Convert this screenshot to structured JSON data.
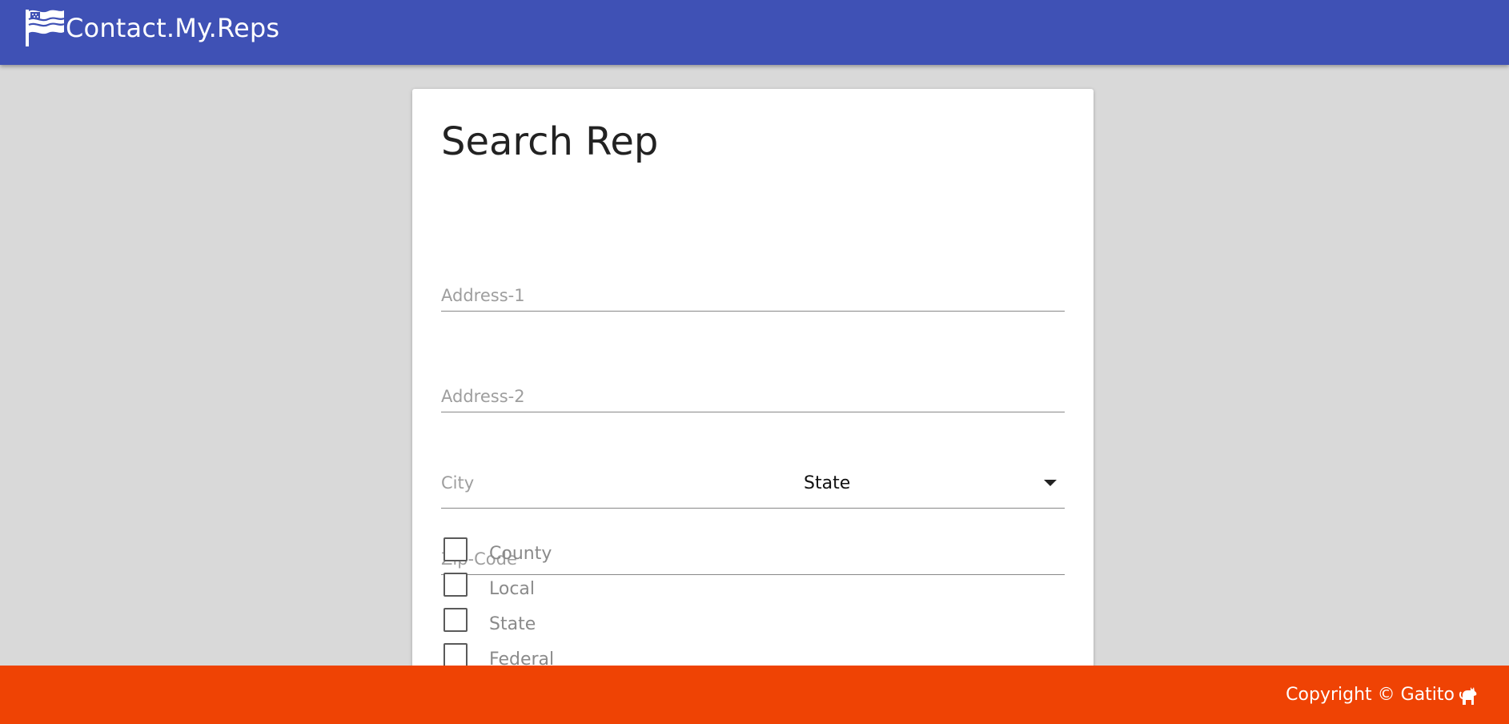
{
  "header": {
    "title": "Contact.My.Reps",
    "logo_icon": "flag-icon",
    "background": "#3f51b5"
  },
  "form": {
    "title": "Search Rep",
    "address1_placeholder": "Address-1",
    "address2_placeholder": "Address-2",
    "city_placeholder": "City",
    "state_selected": "State",
    "zip_placeholder": "Zip-Code",
    "levels": [
      {
        "label": "County",
        "checked": false
      },
      {
        "label": "Local",
        "checked": false
      },
      {
        "label": "State",
        "checked": false
      },
      {
        "label": "Federal",
        "checked": false
      }
    ]
  },
  "footer": {
    "text": "Copyright © Gatito",
    "icon": "cat-icon",
    "background": "#ef4304"
  }
}
